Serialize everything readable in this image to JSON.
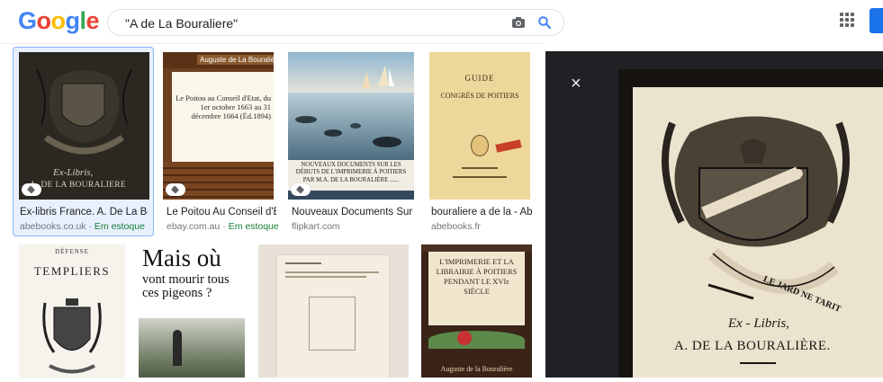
{
  "logo_letters": [
    {
      "ch": "G",
      "color": "#4285f4"
    },
    {
      "ch": "o",
      "color": "#ea4335"
    },
    {
      "ch": "o",
      "color": "#fbbc05"
    },
    {
      "ch": "g",
      "color": "#4285f4"
    },
    {
      "ch": "l",
      "color": "#34a853"
    },
    {
      "ch": "e",
      "color": "#ea4335"
    }
  ],
  "search": {
    "query": "\"A de La Bouraliere\""
  },
  "results": [
    {
      "caption": "Ex-libris France. A. De La Bour...",
      "source": "abebooks.co.uk",
      "stock": "Em estoque",
      "thumb_text_1": "Ex-Libris,",
      "thumb_text_2": "A. DE LA BOURALIERE"
    },
    {
      "caption": "Le Poitou Au Conseil d'Et...",
      "source": "ebay.com.au",
      "stock": "Em estoque",
      "thumb_text_1": "Auguste de La Bouralière",
      "thumb_text_2": "Le Poitou au Conseil d'Etat, du 1er octobre 1663 au 31 décembre 1664 (Éd.1894)"
    },
    {
      "caption": "Nouveaux Documents Sur Le...",
      "source": "flipkart.com",
      "stock": "",
      "thumb_text_1": "Nouveaux Documents Sur Les Débuts De L'imprimerie À Poitiers",
      "thumb_text_2": "Par M.A. De La Bouralière ......"
    },
    {
      "caption": "bouraliere a de la - Abe...",
      "source": "abebooks.fr",
      "stock": "",
      "thumb_text_1": "GUIDE",
      "thumb_text_2": "CONGRÈS DE POITIERS"
    },
    {
      "caption": "",
      "source": "",
      "stock": "",
      "thumb_text_1": "DÉFENSE",
      "thumb_text_2": "TEMPLIERS"
    },
    {
      "caption": "",
      "source": "",
      "stock": "",
      "thumb_text_1": "Mais où",
      "thumb_text_2": "vont mourir tous ces pigeons ?"
    },
    {
      "caption": "",
      "source": "",
      "stock": "",
      "thumb_text_1": "",
      "thumb_text_2": ""
    },
    {
      "caption": "",
      "source": "",
      "stock": "",
      "thumb_text_1": "L'IMPRIMERIE ET LA LIBRAIRIE À POITIERS PENDANT LE XVIe SIÈCLE",
      "thumb_text_2": "Auguste de la Bouralière"
    }
  ],
  "viewer": {
    "close_label": "×",
    "text_1": "Ex - Libris,",
    "text_2": "A. DE LA BOURALIÈRE.",
    "banner": "LE JARD NE TARIT"
  },
  "colors": {
    "accent": "#1a73e8",
    "stock_green": "#188038",
    "source_grey": "#70757a"
  }
}
